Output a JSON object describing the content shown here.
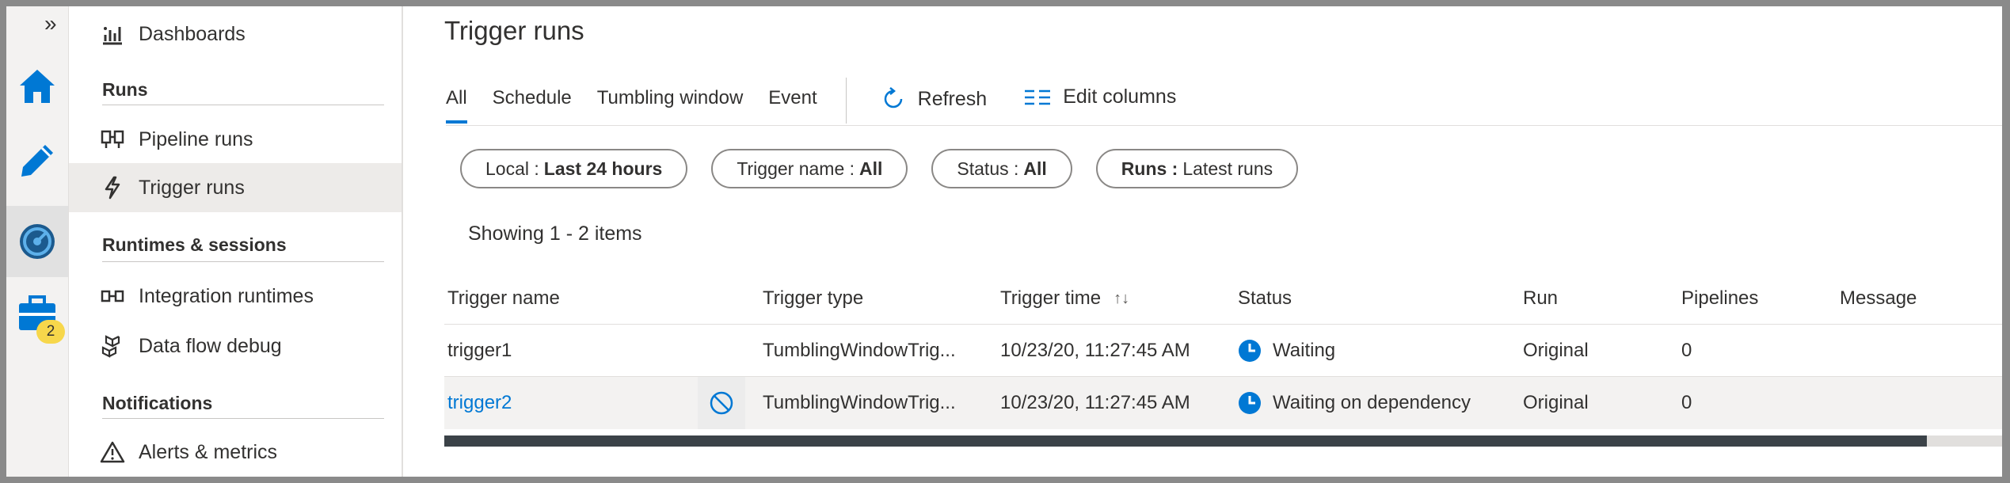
{
  "rail": {
    "expand_glyph": "»",
    "badge_count": "2",
    "icons": [
      "home-icon",
      "pencil-icon",
      "monitor-icon",
      "manage-icon"
    ]
  },
  "nav": {
    "dashboards": "Dashboards",
    "runs_heading": "Runs",
    "pipeline_runs": "Pipeline runs",
    "trigger_runs": "Trigger runs",
    "runtimes_heading": "Runtimes & sessions",
    "integration_runtimes": "Integration runtimes",
    "data_flow_debug": "Data flow debug",
    "notifications_heading": "Notifications",
    "alerts_metrics": "Alerts & metrics"
  },
  "main": {
    "title": "Trigger runs",
    "tabs": [
      "All",
      "Schedule",
      "Tumbling window",
      "Event"
    ],
    "refresh": "Refresh",
    "edit_columns": "Edit columns"
  },
  "filters": [
    {
      "label": "Local : ",
      "value": "Last 24 hours"
    },
    {
      "label": "Trigger name : ",
      "value": "All"
    },
    {
      "label": "Status : ",
      "value": "All"
    },
    {
      "label": "Runs : ",
      "value": "Latest runs"
    }
  ],
  "showing": "Showing 1 - 2 items",
  "table": {
    "columns": [
      "Trigger name",
      "Trigger type",
      "Trigger time",
      "Status",
      "Run",
      "Pipelines",
      "Message"
    ],
    "sort_glyph": "↑↓",
    "rows": [
      {
        "name": "trigger1",
        "type": "TumblingWindowTrig...",
        "time": "10/23/20, 11:27:45 AM",
        "status": "Waiting",
        "run": "Original",
        "pipelines": "0",
        "message": ""
      },
      {
        "name": "trigger2",
        "type": "TumblingWindowTrig...",
        "time": "10/23/20, 11:27:45 AM",
        "status": "Waiting on dependency",
        "run": "Original",
        "pipelines": "0",
        "message": ""
      }
    ]
  },
  "colors": {
    "accent": "#0078d4",
    "badge": "#f7d74b",
    "scroll_thumb": "#3b4248"
  }
}
